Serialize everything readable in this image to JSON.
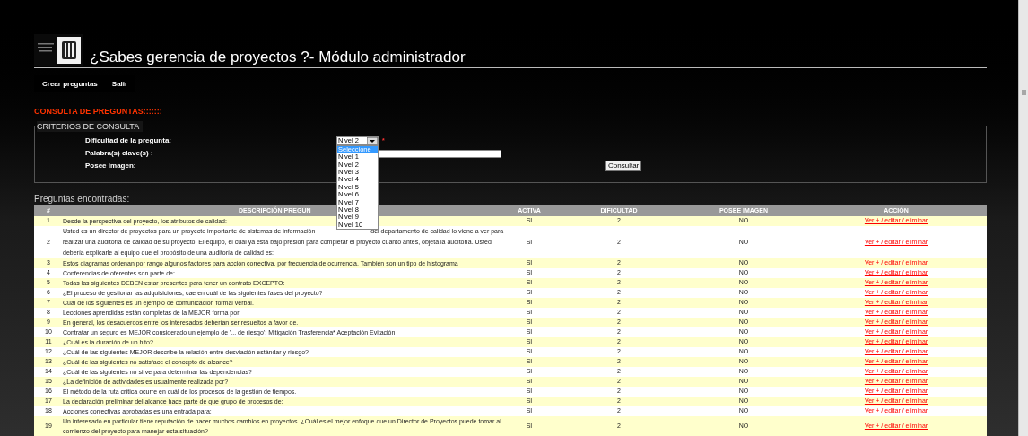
{
  "header": {
    "title": "¿Sabes gerencia de proyectos ?- Módulo administrador"
  },
  "menu": [
    {
      "label": "Crear preguntas"
    },
    {
      "label": "Salir"
    }
  ],
  "section_title": "CONSULTA DE PREGUNTAS:::::::",
  "criteria": {
    "legend": "CRITERIOS DE CONSULTA",
    "difficulty": {
      "label": "Dificultad de la pregunta:",
      "value": "Nivel 2",
      "required_mark": "*",
      "expanded": true,
      "options": [
        {
          "label": "Seleccione",
          "highlighted": true
        },
        {
          "label": "Nivel 1",
          "highlighted": false
        },
        {
          "label": "Nivel 2",
          "highlighted": false
        },
        {
          "label": "Nivel 3",
          "highlighted": false
        },
        {
          "label": "Nivel 4",
          "highlighted": false
        },
        {
          "label": "Nivel 5",
          "highlighted": false
        },
        {
          "label": "Nivel 6",
          "highlighted": false
        },
        {
          "label": "Nivel 7",
          "highlighted": false
        },
        {
          "label": "Nivel 8",
          "highlighted": false
        },
        {
          "label": "Nivel 9",
          "highlighted": false
        },
        {
          "label": "Nivel 10",
          "highlighted": false
        }
      ]
    },
    "keywords": {
      "label": "Palabra(s) clave(s) :"
    },
    "has_image": {
      "label": "Posee imagen:"
    },
    "submit": "Consultar"
  },
  "results": {
    "title": "Preguntas encontradas:",
    "columns": [
      "#",
      "DESCRIPCIÓN PREGUN",
      "ACTIVA",
      "DIFICULTAD",
      "POSEE IMAGEN",
      "ACCIÓN"
    ],
    "rows": [
      {
        "number": "1",
        "description": [
          [
            "Desde la perspectiva del proyecto, los atributos de calidad:"
          ]
        ],
        "active": "SI",
        "difficulty": "2",
        "has_image": "NO",
        "action": "Ver + / editar / eliminar"
      },
      {
        "number": "2",
        "description": [
          [
            "Usted es un director de proyectos para un proyecto importante de sistemas de información",
            "del departamento de calidad lo viene a ver para"
          ],
          [
            "realizar una auditoría de calidad de su proyecto. El equipo, el cual ya está bajo presión para completar el proyecto cuanto antes, objeta la auditoría. Usted"
          ],
          [
            "debería explicarle al equipo que el propósito de una auditoría de calidad es:"
          ]
        ],
        "active": "SI",
        "difficulty": "2",
        "has_image": "NO",
        "action": "Ver + / editar / eliminar"
      },
      {
        "number": "3",
        "description": [
          [
            "Estos diagramas ordenan por rango algunos factores para acción correctiva, por frecuencia de ocurrencia. También son un tipo de histograma"
          ]
        ],
        "active": "SI",
        "difficulty": "2",
        "has_image": "NO",
        "action": "Ver + / editar / eliminar"
      },
      {
        "number": "4",
        "description": [
          [
            "Conferencias de oferentes son parte de:"
          ]
        ],
        "active": "SI",
        "difficulty": "2",
        "has_image": "NO",
        "action": "Ver + / editar / eliminar"
      },
      {
        "number": "5",
        "description": [
          [
            "Todas las siguientes DEBEN estar presentes para tener un contrato EXCEPTO:"
          ]
        ],
        "active": "SI",
        "difficulty": "2",
        "has_image": "NO",
        "action": "Ver + / editar / eliminar"
      },
      {
        "number": "6",
        "description": [
          [
            "¿El proceso de gestionar las adquisiciones, cae en cuál de las siguientes fases del proyecto?"
          ]
        ],
        "active": "SI",
        "difficulty": "2",
        "has_image": "NO",
        "action": "Ver + / editar / eliminar"
      },
      {
        "number": "7",
        "description": [
          [
            "Cuál de los siguientes es un ejemplo de comunicación formal verbal."
          ]
        ],
        "active": "SI",
        "difficulty": "2",
        "has_image": "NO",
        "action": "Ver + / editar / eliminar"
      },
      {
        "number": "8",
        "description": [
          [
            "Lecciones aprendidas están completas de la MEJOR forma por:"
          ]
        ],
        "active": "SI",
        "difficulty": "2",
        "has_image": "NO",
        "action": "Ver + / editar / eliminar"
      },
      {
        "number": "9",
        "description": [
          [
            "En general, los desacuerdos entre los interesados deberían ser resueltos a favor de."
          ]
        ],
        "active": "SI",
        "difficulty": "2",
        "has_image": "NO",
        "action": "Ver + / editar / eliminar"
      },
      {
        "number": "10",
        "description": [
          [
            "Contratar un seguro es MEJOR considerado un ejemplo de '... de riesgo': Mitigación Trasferencia* Aceptación Evitación"
          ]
        ],
        "active": "SI",
        "difficulty": "2",
        "has_image": "NO",
        "action": "Ver + / editar / eliminar"
      },
      {
        "number": "11",
        "description": [
          [
            "¿Cuál es la duración de un hito?"
          ]
        ],
        "active": "SI",
        "difficulty": "2",
        "has_image": "NO",
        "action": "Ver + / editar / eliminar"
      },
      {
        "number": "12",
        "description": [
          [
            "¿Cuál de las siguientes MEJOR describe la relación entre desviación estándar y riesgo?"
          ]
        ],
        "active": "SI",
        "difficulty": "2",
        "has_image": "NO",
        "action": "Ver + / editar / eliminar"
      },
      {
        "number": "13",
        "description": [
          [
            "¿Cuál de las siguientes no satisface el concepto de alcance?"
          ]
        ],
        "active": "SI",
        "difficulty": "2",
        "has_image": "NO",
        "action": "Ver + / editar / eliminar"
      },
      {
        "number": "14",
        "description": [
          [
            "¿Cuál de las siguientes no sirve para determinar las dependencias?"
          ]
        ],
        "active": "SI",
        "difficulty": "2",
        "has_image": "NO",
        "action": "Ver + / editar / eliminar"
      },
      {
        "number": "15",
        "description": [
          [
            "¿La definición de actividades es usualmente realizada por?"
          ]
        ],
        "active": "SI",
        "difficulty": "2",
        "has_image": "NO",
        "action": "Ver + / editar / eliminar"
      },
      {
        "number": "16",
        "description": [
          [
            "El método de la ruta crítica ocurre en cuál de los procesos de la gestión de tiempos."
          ]
        ],
        "active": "SI",
        "difficulty": "2",
        "has_image": "NO",
        "action": "Ver + / editar / eliminar"
      },
      {
        "number": "17",
        "description": [
          [
            "La declaración preliminar del alcance hace parte de que grupo de procesos de:"
          ]
        ],
        "active": "SI",
        "difficulty": "2",
        "has_image": "NO",
        "action": "Ver + / editar / eliminar"
      },
      {
        "number": "18",
        "description": [
          [
            "Acciones correctivas aprobadas es una entrada para:"
          ]
        ],
        "active": "SI",
        "difficulty": "2",
        "has_image": "NO",
        "action": "Ver + / editar / eliminar"
      },
      {
        "number": "19",
        "description": [
          [
            "Un interesado en particular tiene reputación de hacer muchos cambios en proyectos. ¿Cuál es el mejor enfoque que un Director de Proyectos puede tomar al"
          ],
          [
            "comienzo del proyecto para manejar esta situación?"
          ]
        ],
        "active": "SI",
        "difficulty": "2",
        "has_image": "NO",
        "action": "Ver + / editar / eliminar"
      }
    ]
  }
}
